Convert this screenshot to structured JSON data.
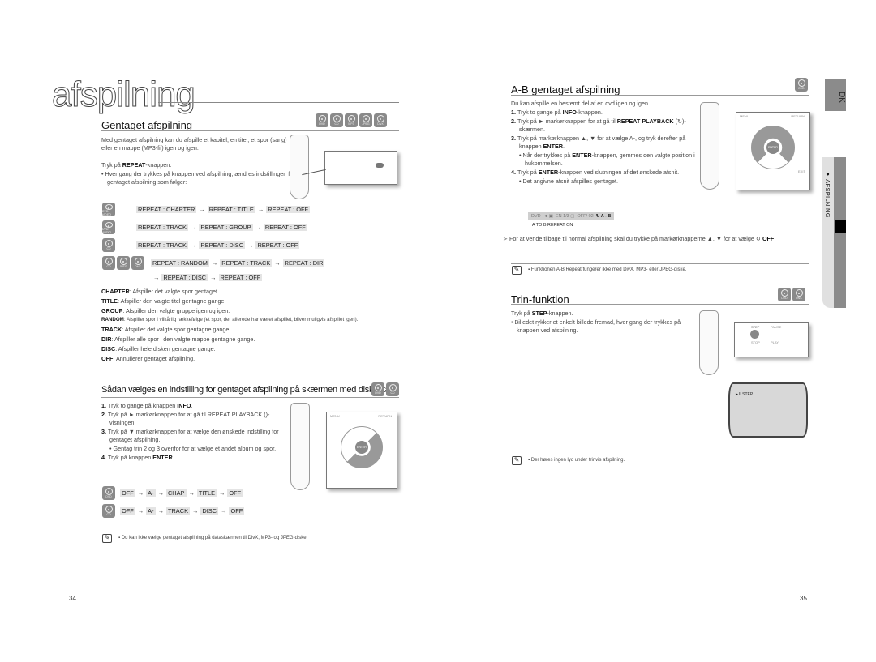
{
  "left_page": {
    "chapter_title": "afspilning",
    "section1": {
      "title": "Gentaget afspilning",
      "disc_icons": [
        "DVD",
        "CD",
        "MP3",
        "JPEG",
        "DivX"
      ],
      "intro": "Med gentaget afspilning kan du afspille et kapitel, en titel, et spor (sang) eller en mappe (MP3-fil) igen og igen.",
      "step_prefix": "Tryk på ",
      "step_bold": "REPEAT",
      "step_suffix": "-knappen.",
      "bullet": "Hver gang der trykkes på knappen ved afspilning, ændres indstillingen for gentaget afspilning som følger:",
      "sequences": [
        {
          "icons": [
            "DVD-VIDEO"
          ],
          "items": [
            "REPEAT : CHAPTER",
            "REPEAT : TITLE",
            "REPEAT : OFF"
          ]
        },
        {
          "icons": [
            "DVD-AUDIO"
          ],
          "items": [
            "REPEAT : TRACK",
            "REPEAT : GROUP",
            "REPEAT : OFF"
          ]
        },
        {
          "icons": [
            "CD"
          ],
          "items": [
            "REPEAT : TRACK",
            "REPEAT : DISC",
            "REPEAT : OFF"
          ]
        },
        {
          "icons": [
            "CD",
            "JPEG",
            "DivX"
          ],
          "items": [
            "REPEAT : RANDOM",
            "REPEAT : TRACK",
            "REPEAT : DIR"
          ],
          "items2": [
            "REPEAT : DISC",
            "REPEAT : OFF"
          ]
        }
      ],
      "definitions": [
        {
          "term": "CHAPTER",
          "text": ": Afspiller det valgte spor gentaget."
        },
        {
          "term": "TITLE",
          "text": ": Afspiller den valgte titel gentagne gange."
        },
        {
          "term": "GROUP",
          "text": ": Afspiller den valgte gruppe igen og igen."
        },
        {
          "term": "RANDOM",
          "text": ": Afspiller spor i vilkårlig rækkefølge (et spor, der allerede har været afspillet, bliver muligvis afspillet igen)."
        },
        {
          "term": "TRACK",
          "text": ": Afspiller det valgte spor gentagne gange."
        },
        {
          "term": "DIR",
          "text": ": Afspiller alle spor i den valgte mappe gentagne gange."
        },
        {
          "term": "DISC",
          "text": ": Afspiller hele disken gentagne gange."
        },
        {
          "term": "OFF",
          "text": ": Annullerer gentaget afspilning."
        }
      ]
    },
    "section2": {
      "title": "Sådan vælges en indstilling for gentaget afspilning på skærmen med diskdata.",
      "disc_icons": [
        "DVD",
        "CD"
      ],
      "steps": [
        {
          "num": "1.",
          "pre": "Tryk to gange på knappen ",
          "bold": "INFO",
          "post": "."
        },
        {
          "num": "2.",
          "pre": "Tryk på ► markørknappen for at gå til REPEAT PLAYBACK (",
          "bold": "",
          "post": ")-visningen."
        },
        {
          "num": "3.",
          "pre": "Tryk på ▼ markørknappen for at vælge den ønskede indstilling for gentaget afspilning.",
          "bold": "",
          "post": ""
        },
        {
          "num": "4.",
          "pre": "Tryk på knappen ",
          "bold": "ENTER",
          "post": "."
        }
      ],
      "step3_bullet": "Gentag trin 2 og 3 ovenfor for at vælge et andet album og spor.",
      "sequences": [
        {
          "icon": "DVD",
          "items": [
            "OFF",
            "A-",
            "CHAP",
            "TITLE",
            "OFF"
          ]
        },
        {
          "icon": "CD",
          "items": [
            "OFF",
            "A-",
            "TRACK",
            "DISC",
            "OFF"
          ]
        }
      ]
    },
    "note": "Du kan ikke vælge gentaget afspilning på dataskærmen til DivX, MP3- og JPEG-diske.",
    "page_number": "34"
  },
  "right_page": {
    "section1": {
      "title": "A-B gentaget afspilning",
      "disc_icons": [
        "DVD"
      ],
      "intro": "Du kan afspille en bestemt del af en dvd igen og igen.",
      "steps": [
        {
          "num": "1.",
          "pre": "Tryk to gange på ",
          "bold": "INFO",
          "post": "-knappen."
        },
        {
          "num": "2.",
          "pre": "Tryk på ► markørknappen for at gå til ",
          "bold": "REPEAT PLAYBACK",
          "post": " (↻)-skærmen."
        },
        {
          "num": "3.",
          "pre": "Tryk på markørknappen ▲, ▼ for at vælge A-, og tryk derefter på knappen ",
          "bold": "ENTER",
          "post": "."
        },
        {
          "num": "4.",
          "pre": "Tryk på ",
          "bold": "ENTER",
          "post": "-knappen ved slutningen af det ønskede afsnit."
        }
      ],
      "step3_bullet_pre": "Når der trykkes på ",
      "step3_bullet_bold": "ENTER",
      "step3_bullet_post": "-knappen, gemmes den valgte position i hukommelsen.",
      "step4_bullet": "Det angivne afsnit afspilles gentaget.",
      "info_bar": {
        "items": [
          "DVD",
          "◄",
          "EN 1/3",
          "",
          "OFF/ 02"
        ],
        "active": "A - B"
      },
      "info_caption": "A TO B REPEAT ON",
      "tip_text": "For at vende tilbage til normal afspilning skal du trykke på markørknapperne ▲, ▼ for at vælge ",
      "tip_bold": "OFF",
      "note": "Funktionen A-B Repeat fungerer ikke med DivX, MP3- eller JPEG-diske."
    },
    "section2": {
      "title": "Trin-funktion",
      "disc_icons": [
        "DVD",
        "DivX"
      ],
      "step_prefix": "Tryk på ",
      "step_bold": "STEP",
      "step_suffix": "-knappen.",
      "bullet": "Billedet rykker et enkelt billede fremad, hver gang der trykkes på knappen ved afspilning.",
      "remote_labels": {
        "step": "STEP",
        "pause": "PAUSE",
        "stop": "STOP",
        "play": "PLAY"
      },
      "tv_text": "►II STEP",
      "note": "Der høres ingen lyd under trinvis afspilning."
    },
    "remote_labels": {
      "menu": "MENU",
      "return": "RETURN",
      "enter": "ENTER",
      "exit": "EXIT"
    },
    "page_number": "35",
    "side_tab_lang": "DK",
    "side_tab_label": "● AFSPILNING"
  }
}
